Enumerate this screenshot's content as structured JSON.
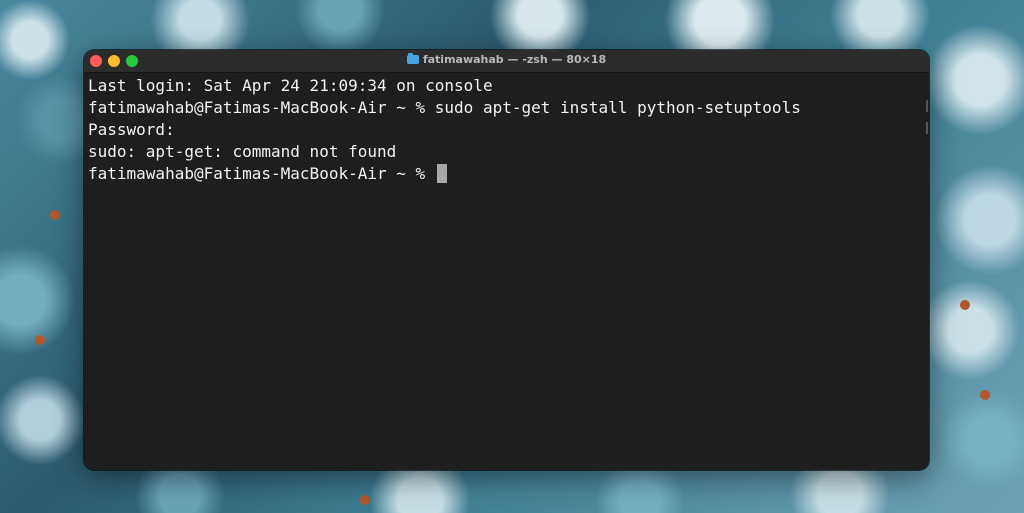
{
  "window": {
    "title": "fatimawahab — -zsh — 80×18"
  },
  "terminal": {
    "lines": [
      "Last login: Sat Apr 24 21:09:34 on console",
      "fatimawahab@Fatimas-MacBook-Air ~ % sudo apt-get install python-setuptools",
      "Password:",
      "sudo: apt-get: command not found"
    ],
    "prompt": "fatimawahab@Fatimas-MacBook-Air ~ % "
  },
  "colors": {
    "terminal_bg": "#1e1e1e",
    "text": "#f2f2f2",
    "close": "#ff5f57",
    "minimize": "#febc2e",
    "zoom": "#28c840"
  }
}
